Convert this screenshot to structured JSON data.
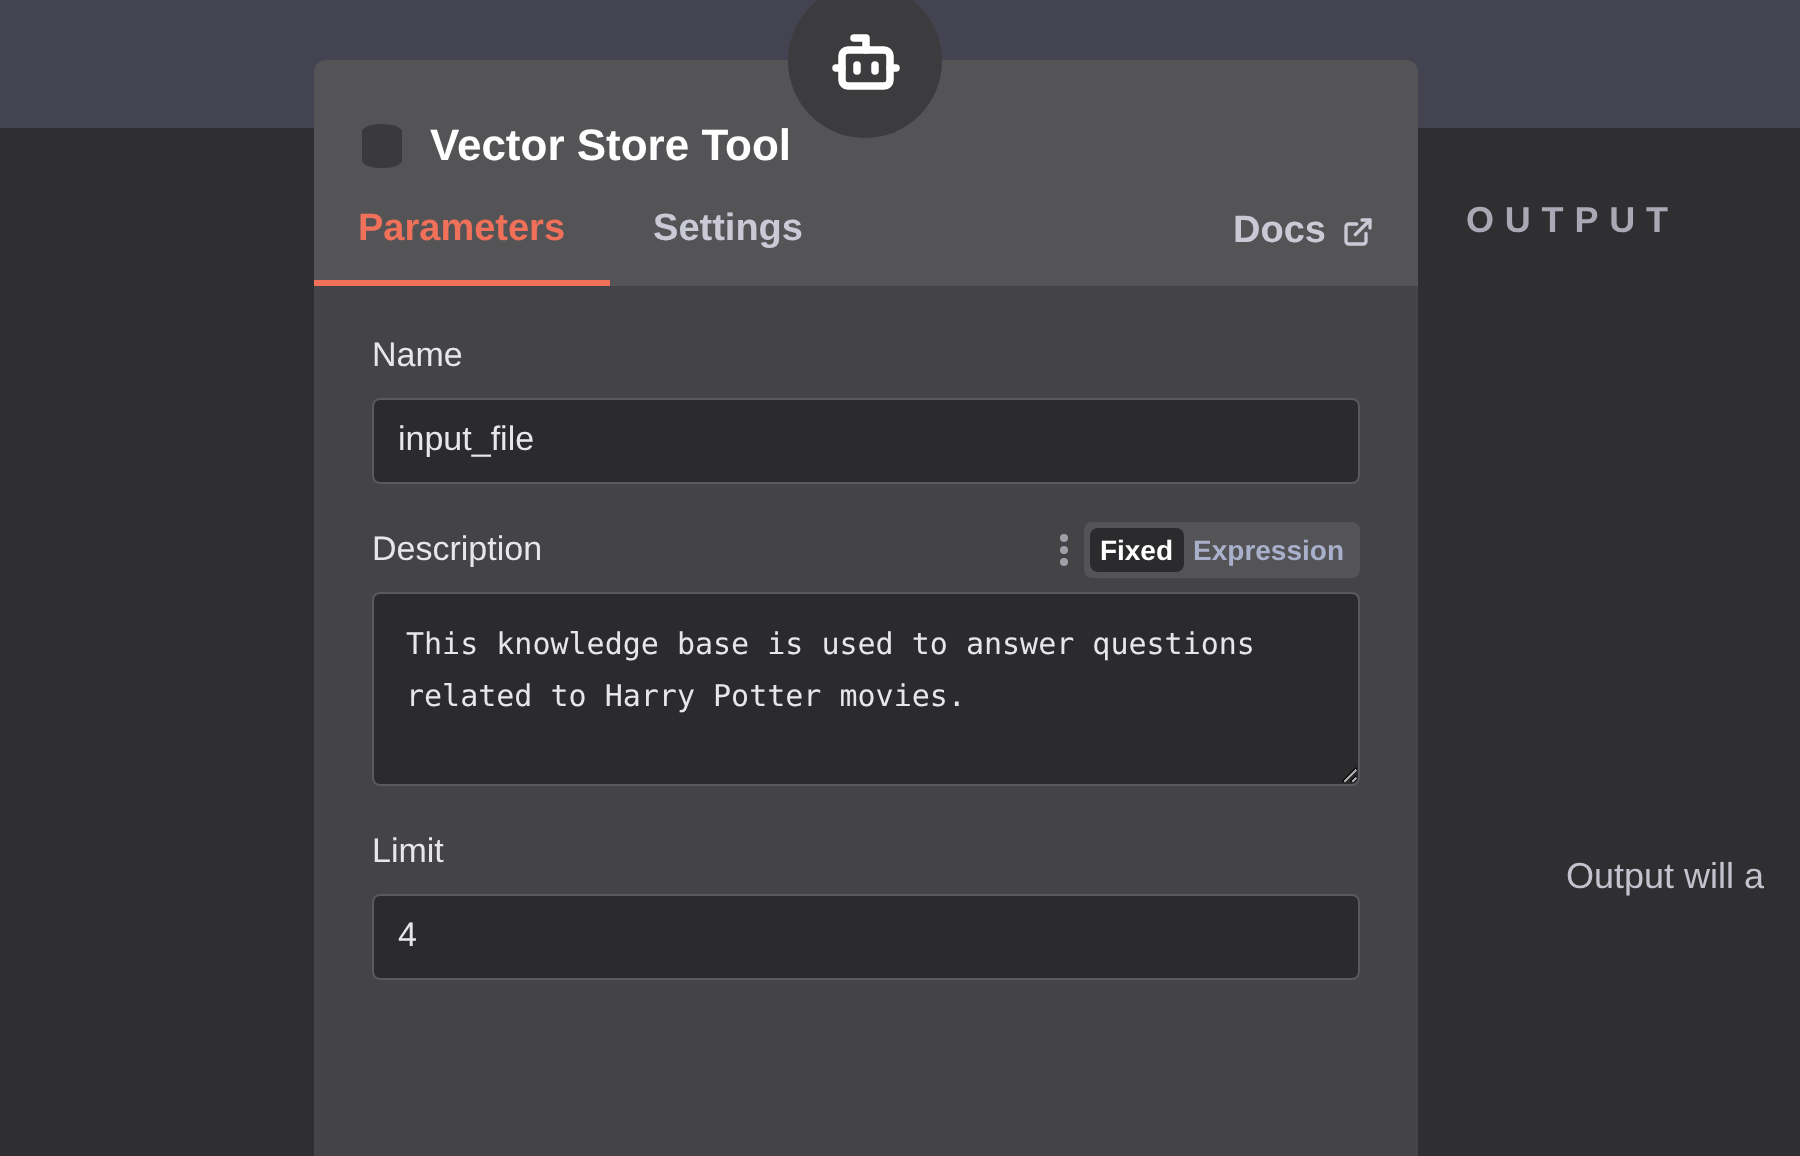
{
  "node": {
    "title": "Vector Store Tool"
  },
  "tabs": [
    {
      "label": "Parameters",
      "selected": true
    },
    {
      "label": "Settings",
      "selected": false
    }
  ],
  "docs_link": "Docs",
  "fields": [
    {
      "kind": "input",
      "label": "Name",
      "value": "input_file"
    },
    {
      "kind": "textarea",
      "label": "Description",
      "value": "This knowledge base is used to answer questions related to Harry Potter movies.",
      "modes": [
        {
          "label": "Fixed",
          "selected": true
        },
        {
          "label": "Expression",
          "selected": false
        }
      ]
    },
    {
      "kind": "input",
      "label": "Limit",
      "value": "4"
    }
  ],
  "output": {
    "heading": "OUTPUT",
    "message": "Output will a"
  }
}
